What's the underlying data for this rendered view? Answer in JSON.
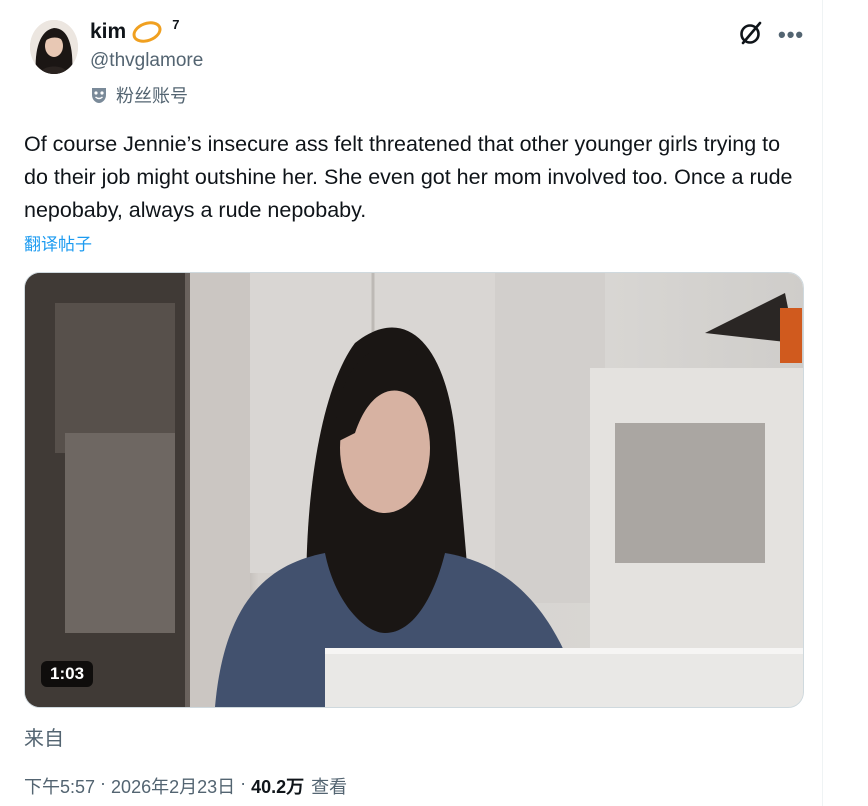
{
  "author": {
    "display_name": "kim",
    "superscript": "7",
    "handle": "@thvglamore",
    "fan_label": "粉丝账号",
    "avatar_icon": "avatar-photo",
    "badge_icon": "orange-ring-emoji"
  },
  "tweet": {
    "text": "Of course Jennie’s insecure ass felt threatened that other younger girls trying to do their job might outshine her. She even got her mom involved too. Once a rude nepobaby, always a rude nepobaby.",
    "translate_label": "翻译帖子"
  },
  "media": {
    "duration": "1:03"
  },
  "source_label": "来自",
  "meta": {
    "time": "下午5:57",
    "separator": " · ",
    "date": "2026年2月23日",
    "views_count": "40.2万",
    "views_label": "查看"
  },
  "colors": {
    "text": "#0f1419",
    "muted": "#536471",
    "link": "#1d9bf0"
  }
}
